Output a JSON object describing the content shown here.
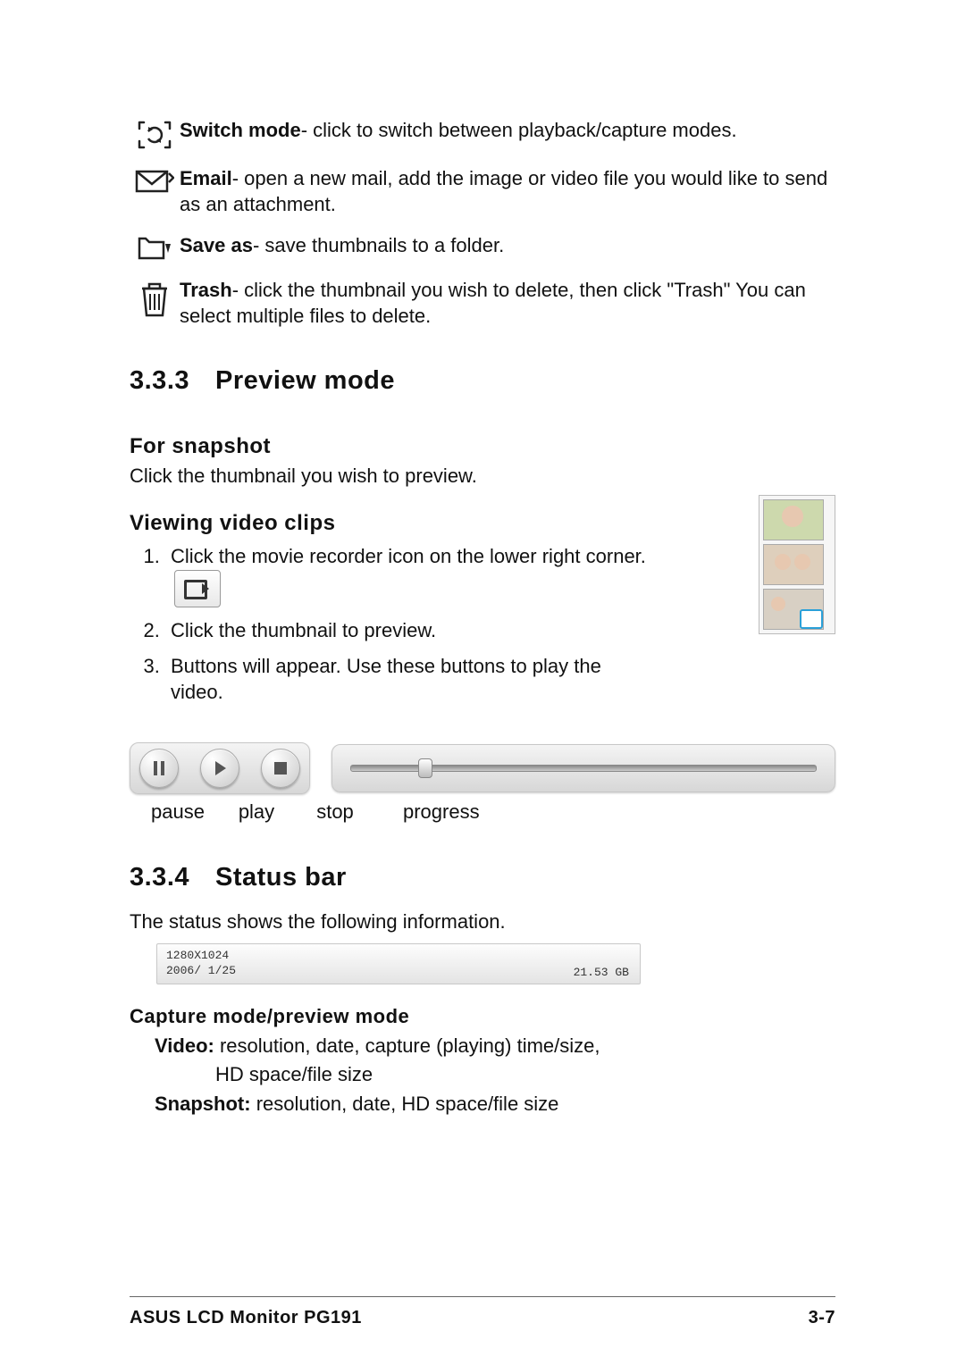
{
  "defs": {
    "switch_mode": {
      "label": "Switch mode",
      "desc": "- click to switch between playback/capture modes."
    },
    "email": {
      "label": "Email",
      "desc": "- open a new mail, add the image or video file you would like to send as an attachment."
    },
    "save_as": {
      "label": "Save as",
      "desc": "- save thumbnails to a folder."
    },
    "trash": {
      "label": "Trash",
      "desc": "- click the thumbnail you wish to delete, then click \"Trash\" You can select multiple files to delete."
    }
  },
  "sec333": {
    "num": "3.3.3",
    "title": "Preview mode",
    "snapshot_heading": "For snapshot",
    "snapshot_text": "Click the thumbnail you wish to preview.",
    "clips_heading": "Viewing video clips",
    "steps": [
      "Click the movie recorder icon on the lower right corner.",
      "Click the thumbnail to preview.",
      "Buttons will appear. Use these buttons to play the video."
    ]
  },
  "play_labels": {
    "pause": "pause",
    "play": "play",
    "stop": "stop",
    "progress": "progress"
  },
  "sec334": {
    "num": "3.3.4",
    "title": "Status bar",
    "intro": "The status shows the following information.",
    "bar": {
      "resolution": "1280X1024",
      "date": "2006/ 1/25",
      "size": "21.53 GB"
    },
    "mode_heading": "Capture mode/preview mode",
    "video_label": "Video:",
    "video_desc1": "resolution, date, capture (playing) time/size,",
    "video_desc2": "HD space/file size",
    "snapshot_label": "Snapshot:",
    "snapshot_desc": "resolution, date, HD space/file size"
  },
  "footer": {
    "left": "ASUS LCD Monitor PG191",
    "right": "3-7"
  }
}
